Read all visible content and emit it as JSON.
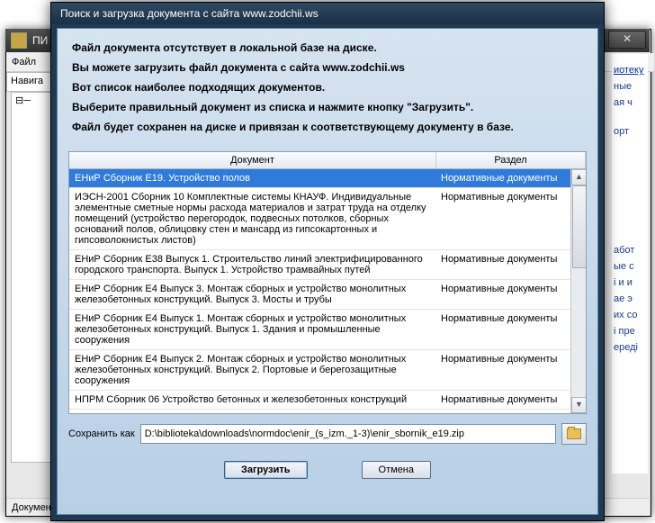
{
  "bg": {
    "title": "ПИ",
    "menu_file": "Файл",
    "nav": "Навига",
    "tree_node": "⊟─",
    "right_items": [
      "иотеку",
      "ные",
      "ая ч",
      "орт",
      "абот",
      "ые с",
      "і и и",
      "ае э",
      "их со",
      "і пре",
      "ереді"
    ],
    "status": "Докумен"
  },
  "dialog": {
    "title": "Поиск и загрузка документа с сайта www.zodchii.ws",
    "line1": "Файл документа отсутствует в локальной базе на диске.",
    "line2": "Вы можете загрузить файл документа с сайта www.zodchii.ws",
    "line3": "Вот список наиболее подходящих документов.",
    "line4": "Выберите правильный документ из списка и нажмите кнопку \"Загрузить\".",
    "line5": "Файл будет сохранен на диске и привязан к соответствующему документу в базе.",
    "col_doc": "Документ",
    "col_sec": "Раздел",
    "rows": [
      {
        "doc": "ЕНиР Сборник Е19. Устройство полов",
        "sec": "Нормативные документы",
        "selected": true
      },
      {
        "doc": "ИЭСН-2001 Сборник 10 Комплектные системы КНАУФ. Индивидуальные элементные сметные нормы расхода материалов и затрат труда на отделку помещений (устройство перегородок, подвесных потолков, сборных оснований полов, облицовку стен и мансард из гипсокартонных и гипсоволокнистых листов)",
        "sec": "Нормативные документы"
      },
      {
        "doc": "ЕНиР Сборник Е38 Выпуск 1. Строительство линий электрифицированного городского транспорта. Выпуск 1. Устройство трамвайных путей",
        "sec": "Нормативные документы"
      },
      {
        "doc": "ЕНиР Сборник Е4 Выпуск 3. Монтаж сборных и устройство монолитных железобетонных конструкций. Выпуск 3. Мосты и трубы",
        "sec": "Нормативные документы"
      },
      {
        "doc": "ЕНиР Сборник Е4 Выпуск 1. Монтаж сборных и устройство монолитных железобетонных конструкций. Выпуск 1. Здания и промышленные сооружения",
        "sec": "Нормативные документы"
      },
      {
        "doc": "ЕНиР Сборник Е4 Выпуск 2. Монтаж сборных и устройство монолитных железобетонных конструкций. Выпуск 2. Портовые и берегозащитные сооружения",
        "sec": "Нормативные документы"
      },
      {
        "doc": "НПРМ Сборник 06 Устройство бетонных и железобетонных конструкций",
        "sec": "Нормативные документы"
      }
    ],
    "save_as_label": "Сохранить как",
    "save_as_path": "D:\\biblioteka\\downloads\\normdoc\\enir_(s_izm._1-3)\\enir_sbornik_e19.zip",
    "btn_download": "Загрузить",
    "btn_cancel": "Отмена"
  }
}
